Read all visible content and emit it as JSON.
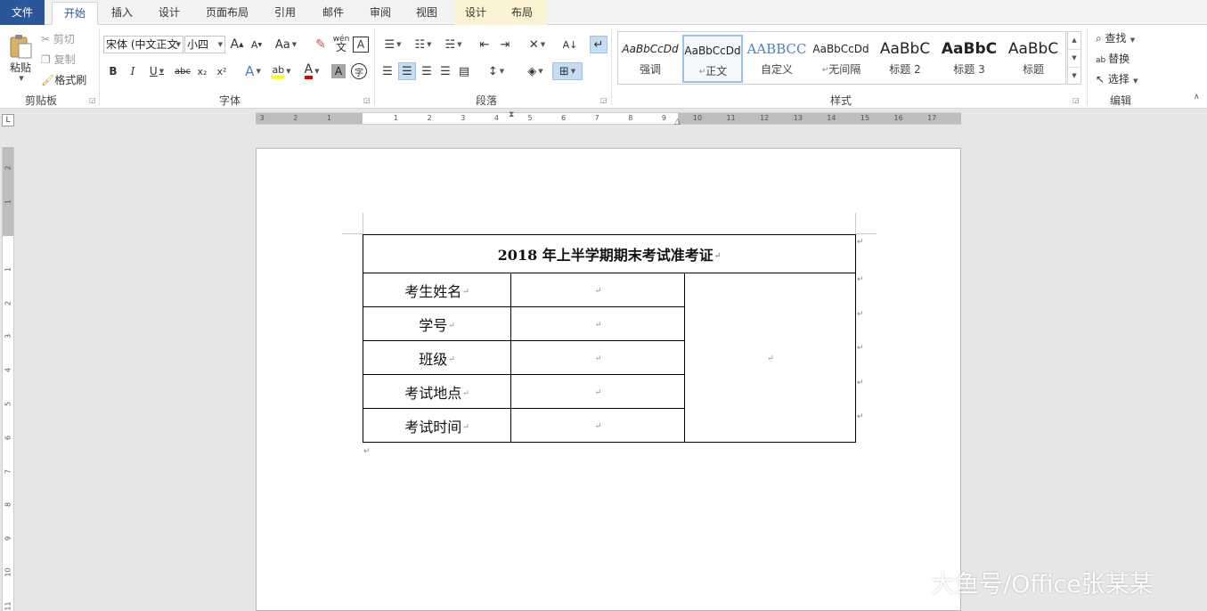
{
  "tabs": {
    "file": "文件",
    "home": "开始",
    "insert": "插入",
    "design": "设计",
    "layout": "页面布局",
    "references": "引用",
    "mailings": "邮件",
    "review": "审阅",
    "view": "视图",
    "table_design": "设计",
    "table_layout": "布局"
  },
  "clipboard": {
    "paste": "粘贴",
    "cut": "剪切",
    "copy": "复制",
    "format_painter": "格式刷",
    "group_label": "剪贴板"
  },
  "font": {
    "font_name": "宋体 (中文正文",
    "font_size": "小四",
    "grow": "A",
    "shrink": "A",
    "change_case": "Aa",
    "pinyin": "wén",
    "border_char": "A",
    "bold": "B",
    "italic": "I",
    "underline": "U",
    "strikethrough": "abc",
    "subscript": "x₂",
    "superscript": "x²",
    "text_effects": "A",
    "highlight": "ab",
    "font_color": "A",
    "char_shading": "A",
    "enclose": "字",
    "group_label": "字体"
  },
  "paragraph": {
    "group_label": "段落"
  },
  "styles": {
    "items": [
      {
        "preview": "AaBbCcDd",
        "name": "强调"
      },
      {
        "preview": "AaBbCcDd",
        "name": "正文"
      },
      {
        "preview": "AABBCC",
        "name": "自定义"
      },
      {
        "preview": "AaBbCcDd",
        "name": "无间隔"
      },
      {
        "preview": "AaBbC",
        "name": "标题 2"
      },
      {
        "preview": "AaBbC",
        "name": "标题 3"
      },
      {
        "preview": "AaBbC",
        "name": "标题"
      }
    ],
    "group_label": "样式"
  },
  "editing": {
    "find": "查找",
    "replace": "替换",
    "select": "选择",
    "group_label": "编辑"
  },
  "ruler": {
    "corner": "L",
    "h_numbers": [
      "3",
      "2",
      "1",
      "1",
      "2",
      "3",
      "4",
      "5",
      "6",
      "7",
      "8",
      "9",
      "10",
      "11",
      "12",
      "13",
      "14",
      "15",
      "16",
      "17"
    ],
    "v_numbers": [
      "2",
      "1",
      "1",
      "2",
      "3",
      "4",
      "5",
      "6",
      "7",
      "8",
      "9",
      "10",
      "11"
    ]
  },
  "document": {
    "table": {
      "title": "2018 年上半学期期末考试准考证",
      "rows": [
        {
          "label": "考生姓名"
        },
        {
          "label": "学号"
        },
        {
          "label": "班级"
        },
        {
          "label": "考试地点"
        },
        {
          "label": "考试时间"
        }
      ]
    }
  },
  "watermark": "大鱼号/Office张某某"
}
